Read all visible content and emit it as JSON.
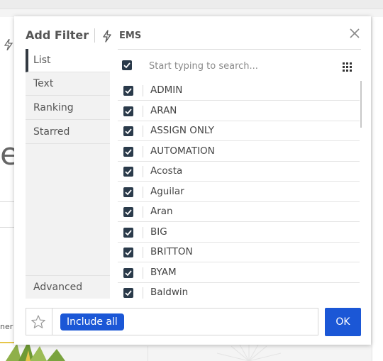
{
  "background": {
    "fragment_text": "ner"
  },
  "dialog": {
    "title": "Add Filter",
    "dataset_label": "EMS",
    "tabs": [
      {
        "label": "List",
        "active": true
      },
      {
        "label": "Text",
        "active": false
      },
      {
        "label": "Ranking",
        "active": false
      },
      {
        "label": "Starred",
        "active": false
      }
    ],
    "advanced_label": "Advanced",
    "search": {
      "placeholder": "Start typing to search...",
      "value": ""
    },
    "items": [
      {
        "label": "ADMIN",
        "checked": true
      },
      {
        "label": "ARAN",
        "checked": true
      },
      {
        "label": "ASSIGN ONLY",
        "checked": true
      },
      {
        "label": "AUTOMATION",
        "checked": true
      },
      {
        "label": "Acosta",
        "checked": true
      },
      {
        "label": "Aguilar",
        "checked": true
      },
      {
        "label": "Aran",
        "checked": true
      },
      {
        "label": "BIG",
        "checked": true
      },
      {
        "label": "BRITTON",
        "checked": true
      },
      {
        "label": "BYAM",
        "checked": true
      },
      {
        "label": "Baldwin",
        "checked": true
      }
    ],
    "footer": {
      "include_label": "Include all",
      "ok_label": "OK"
    }
  },
  "icons": {
    "close": "close-icon",
    "bolt": "bolt-icon",
    "grid": "grid-icon",
    "star": "star-icon",
    "checkbox": "checkbox-checked-icon"
  },
  "colors": {
    "accent": "#1b57d6",
    "checkbox": "#2a3a4a",
    "active_tab_marker": "#333a42"
  }
}
